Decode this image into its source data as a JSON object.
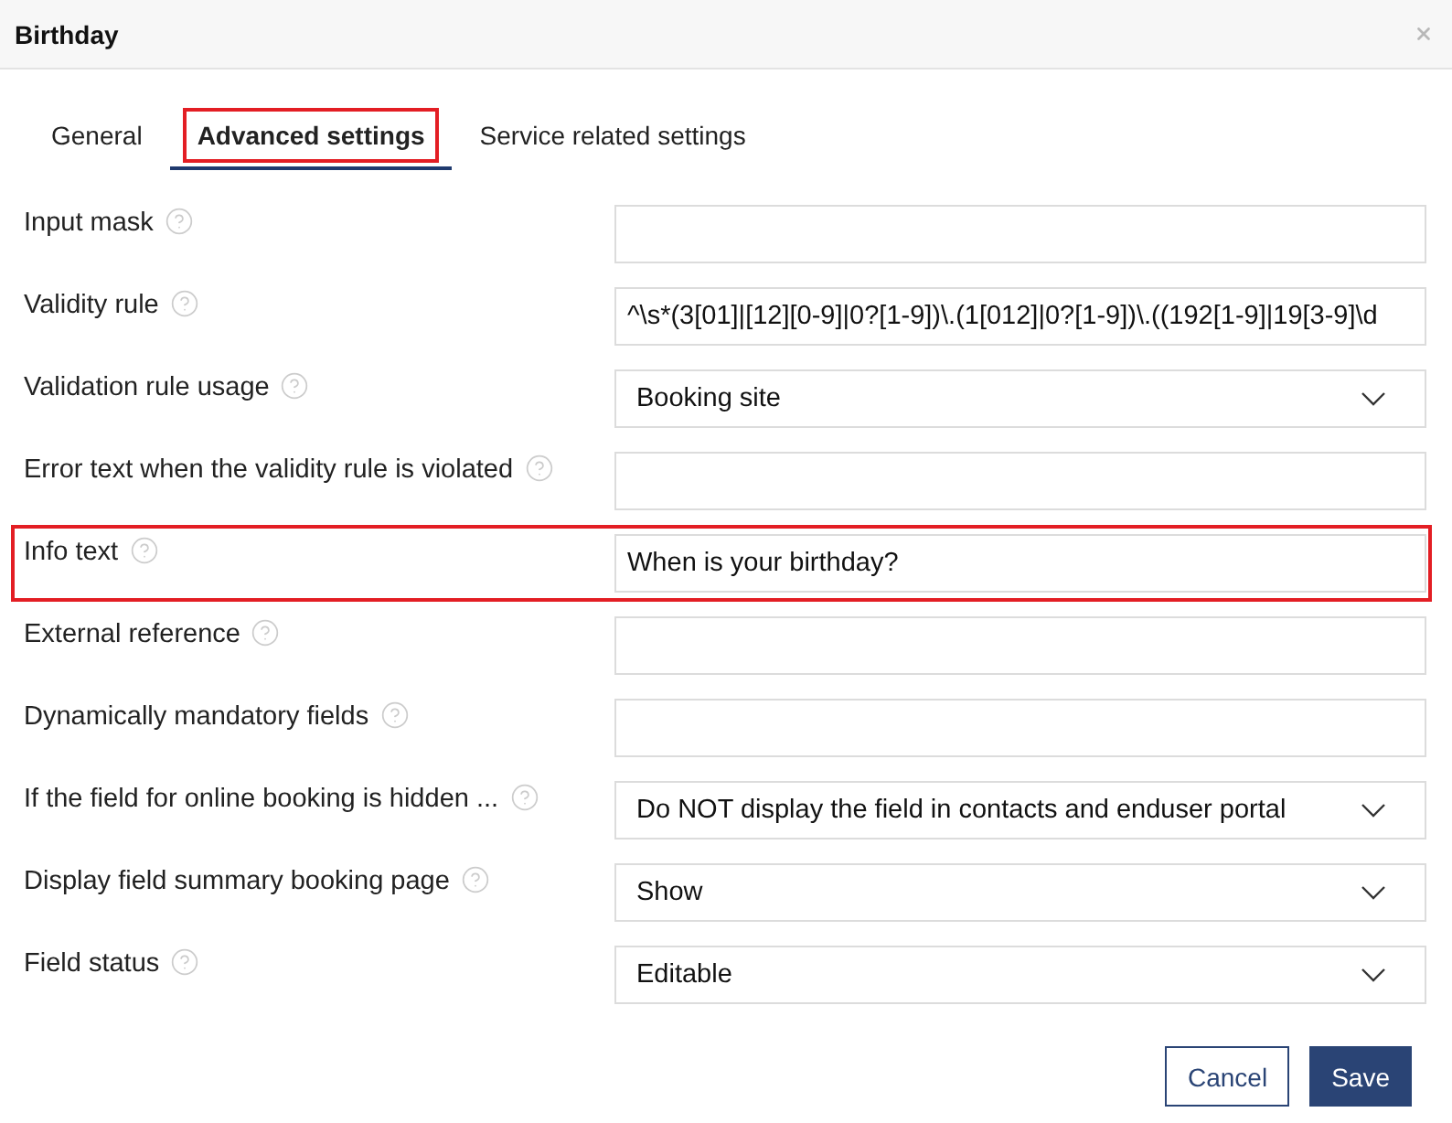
{
  "dialog": {
    "title": "Birthday"
  },
  "tabs": [
    {
      "label": "General",
      "selected": false,
      "highlighted": false
    },
    {
      "label": "Advanced settings",
      "selected": true,
      "highlighted": true
    },
    {
      "label": "Service related settings",
      "selected": false,
      "highlighted": false
    }
  ],
  "fields": [
    {
      "label": "Input mask",
      "kind": "text",
      "highlighted": false
    },
    {
      "label": "Validity rule",
      "kind": "text",
      "value": "^\\s*(3[01]|[12][0-9]|0?[1-9])\\.(1[012]|0?[1-9])\\.((192[1-9]|19[3-9]\\d",
      "highlighted": false
    },
    {
      "label": "Validation rule usage",
      "kind": "select",
      "value": "Booking site",
      "highlighted": false
    },
    {
      "label": "Error text when the validity rule is violated",
      "kind": "text",
      "highlighted": false
    },
    {
      "label": "Info text",
      "kind": "text",
      "value": "When is your birthday?",
      "highlighted": true
    },
    {
      "label": "External reference",
      "kind": "text",
      "highlighted": false
    },
    {
      "label": "Dynamically mandatory fields",
      "kind": "text",
      "highlighted": false
    },
    {
      "label": "If the field for online booking is hidden ...",
      "kind": "select",
      "value": "Do NOT display the field in contacts and enduser portal",
      "highlighted": false
    },
    {
      "label": "Display field summary booking page",
      "kind": "select",
      "value": "Show",
      "highlighted": false
    },
    {
      "label": "Field status",
      "kind": "select",
      "value": "Editable",
      "highlighted": false
    }
  ],
  "buttons": [
    {
      "label": "Cancel",
      "kind": "secondary"
    },
    {
      "label": "Save",
      "kind": "primary"
    }
  ]
}
